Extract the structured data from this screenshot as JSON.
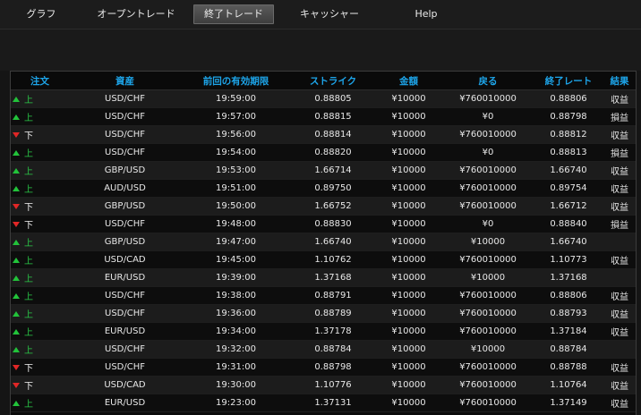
{
  "nav": {
    "tabs": [
      {
        "label": "グラフ"
      },
      {
        "label": "オープントレード"
      },
      {
        "label": "終了トレード"
      },
      {
        "label": "キャッシャー"
      },
      {
        "label": "Help"
      }
    ],
    "active_tab": "終了トレード"
  },
  "table": {
    "headers": [
      "注文",
      "資産",
      "前回の有効期限",
      "ストライク",
      "金額",
      "戻る",
      "終了レート",
      "結果"
    ],
    "rows": [
      {
        "dir": "up",
        "dir_label": "上",
        "asset": "USD/CHF",
        "expiry": "19:59:00",
        "strike": "0.88805",
        "amount": "¥10000",
        "return": "¥760010000",
        "close_rate": "0.88806",
        "result": "収益"
      },
      {
        "dir": "up",
        "dir_label": "上",
        "asset": "USD/CHF",
        "expiry": "19:57:00",
        "strike": "0.88815",
        "amount": "¥10000",
        "return": "¥0",
        "close_rate": "0.88798",
        "result": "損益"
      },
      {
        "dir": "down",
        "dir_label": "下",
        "asset": "USD/CHF",
        "expiry": "19:56:00",
        "strike": "0.88814",
        "amount": "¥10000",
        "return": "¥760010000",
        "close_rate": "0.88812",
        "result": "収益"
      },
      {
        "dir": "up",
        "dir_label": "上",
        "asset": "USD/CHF",
        "expiry": "19:54:00",
        "strike": "0.88820",
        "amount": "¥10000",
        "return": "¥0",
        "close_rate": "0.88813",
        "result": "損益"
      },
      {
        "dir": "up",
        "dir_label": "上",
        "asset": "GBP/USD",
        "expiry": "19:53:00",
        "strike": "1.66714",
        "amount": "¥10000",
        "return": "¥760010000",
        "close_rate": "1.66740",
        "result": "収益"
      },
      {
        "dir": "up",
        "dir_label": "上",
        "asset": "AUD/USD",
        "expiry": "19:51:00",
        "strike": "0.89750",
        "amount": "¥10000",
        "return": "¥760010000",
        "close_rate": "0.89754",
        "result": "収益"
      },
      {
        "dir": "down",
        "dir_label": "下",
        "asset": "GBP/USD",
        "expiry": "19:50:00",
        "strike": "1.66752",
        "amount": "¥10000",
        "return": "¥760010000",
        "close_rate": "1.66712",
        "result": "収益"
      },
      {
        "dir": "down",
        "dir_label": "下",
        "asset": "USD/CHF",
        "expiry": "19:48:00",
        "strike": "0.88830",
        "amount": "¥10000",
        "return": "¥0",
        "close_rate": "0.88840",
        "result": "損益"
      },
      {
        "dir": "up",
        "dir_label": "上",
        "asset": "GBP/USD",
        "expiry": "19:47:00",
        "strike": "1.66740",
        "amount": "¥10000",
        "return": "¥10000",
        "close_rate": "1.66740",
        "result": ""
      },
      {
        "dir": "up",
        "dir_label": "上",
        "asset": "USD/CAD",
        "expiry": "19:45:00",
        "strike": "1.10762",
        "amount": "¥10000",
        "return": "¥760010000",
        "close_rate": "1.10773",
        "result": "収益"
      },
      {
        "dir": "up",
        "dir_label": "上",
        "asset": "EUR/USD",
        "expiry": "19:39:00",
        "strike": "1.37168",
        "amount": "¥10000",
        "return": "¥10000",
        "close_rate": "1.37168",
        "result": ""
      },
      {
        "dir": "up",
        "dir_label": "上",
        "asset": "USD/CHF",
        "expiry": "19:38:00",
        "strike": "0.88791",
        "amount": "¥10000",
        "return": "¥760010000",
        "close_rate": "0.88806",
        "result": "収益"
      },
      {
        "dir": "up",
        "dir_label": "上",
        "asset": "USD/CHF",
        "expiry": "19:36:00",
        "strike": "0.88789",
        "amount": "¥10000",
        "return": "¥760010000",
        "close_rate": "0.88793",
        "result": "収益"
      },
      {
        "dir": "up",
        "dir_label": "上",
        "asset": "EUR/USD",
        "expiry": "19:34:00",
        "strike": "1.37178",
        "amount": "¥10000",
        "return": "¥760010000",
        "close_rate": "1.37184",
        "result": "収益"
      },
      {
        "dir": "up",
        "dir_label": "上",
        "asset": "USD/CHF",
        "expiry": "19:32:00",
        "strike": "0.88784",
        "amount": "¥10000",
        "return": "¥10000",
        "close_rate": "0.88784",
        "result": ""
      },
      {
        "dir": "down",
        "dir_label": "下",
        "asset": "USD/CHF",
        "expiry": "19:31:00",
        "strike": "0.88798",
        "amount": "¥10000",
        "return": "¥760010000",
        "close_rate": "0.88788",
        "result": "収益"
      },
      {
        "dir": "down",
        "dir_label": "下",
        "asset": "USD/CAD",
        "expiry": "19:30:00",
        "strike": "1.10776",
        "amount": "¥10000",
        "return": "¥760010000",
        "close_rate": "1.10764",
        "result": "収益"
      },
      {
        "dir": "up",
        "dir_label": "上",
        "asset": "EUR/USD",
        "expiry": "19:23:00",
        "strike": "1.37131",
        "amount": "¥10000",
        "return": "¥760010000",
        "close_rate": "1.37149",
        "result": "収益"
      }
    ]
  },
  "colors": {
    "header_text": "#1da5ea",
    "up_arrow": "#22c33a",
    "down_arrow": "#e12626"
  },
  "icons": {
    "up": "triangle-up-icon",
    "down": "triangle-down-icon"
  }
}
